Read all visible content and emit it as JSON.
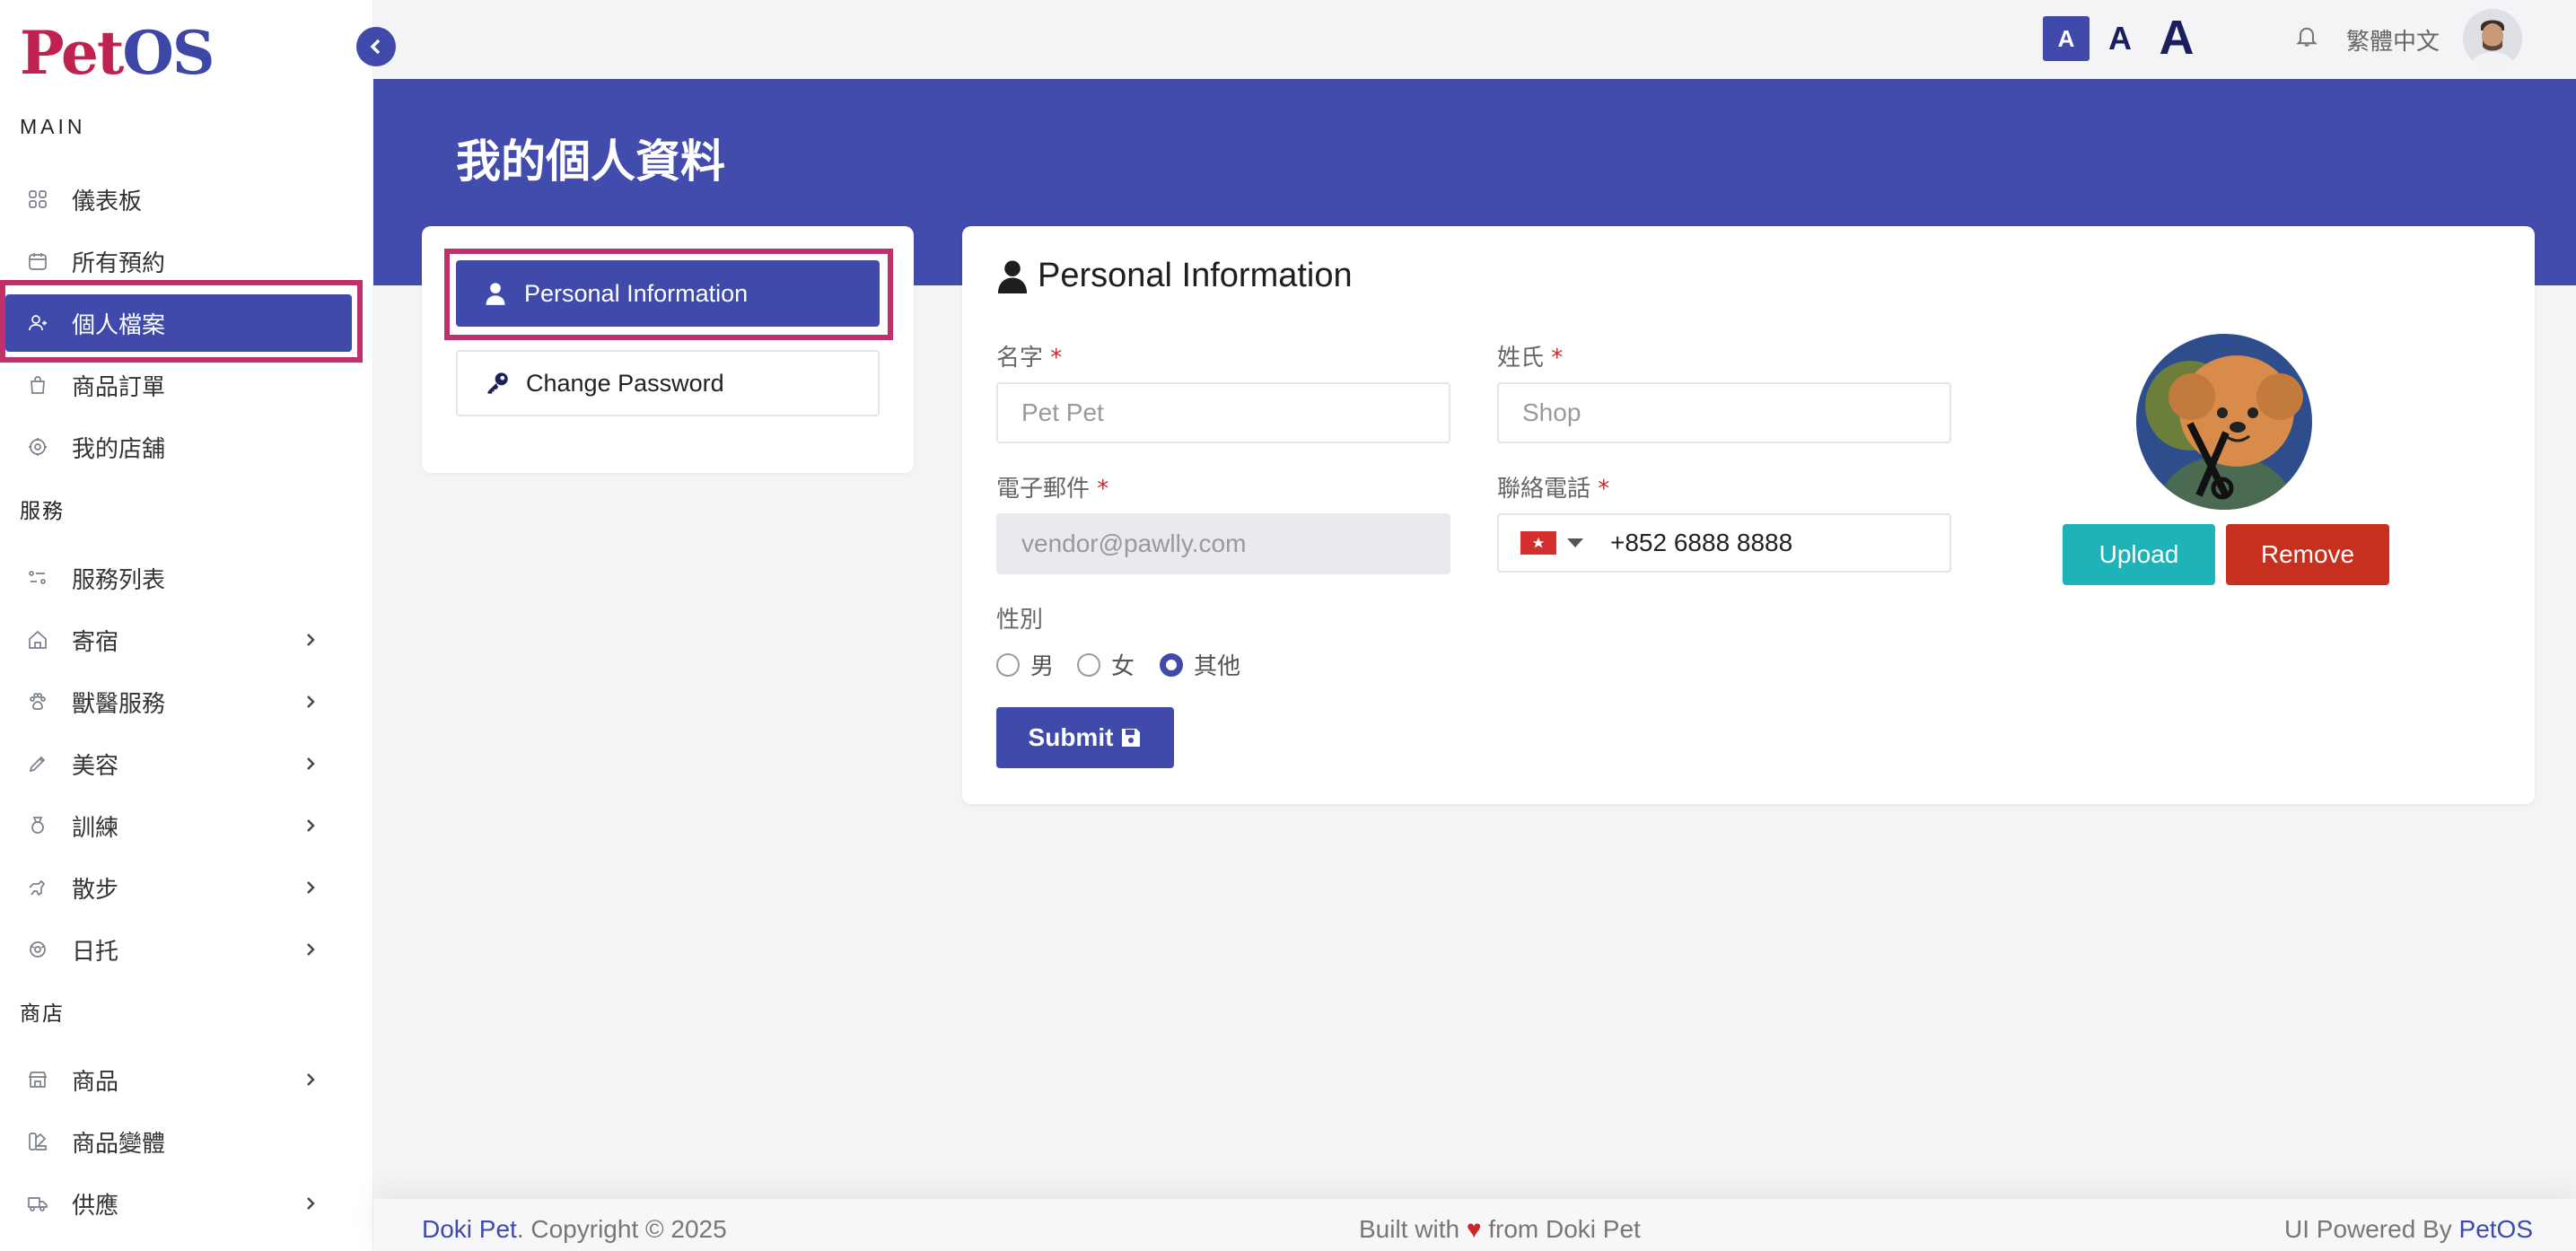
{
  "app": {
    "logo_pet": "Pet",
    "logo_os": "OS",
    "brand_color": "#c0224f",
    "accent": "#3f4aab"
  },
  "sidebar": {
    "sections": {
      "main": "MAIN",
      "services": "服務",
      "shop": "商店"
    },
    "items": [
      {
        "label": "儀表板",
        "icon": "dashboard-icon"
      },
      {
        "label": "所有預約",
        "icon": "calendar-icon"
      },
      {
        "label": "個人檔案",
        "icon": "user-icon",
        "active": true
      },
      {
        "label": "商品訂單",
        "icon": "bag-icon"
      },
      {
        "label": "我的店舖",
        "icon": "store-icon"
      },
      {
        "label": "服務列表",
        "icon": "list-icon"
      },
      {
        "label": "寄宿",
        "icon": "home-icon"
      },
      {
        "label": "獸醫服務",
        "icon": "paw-icon"
      },
      {
        "label": "美容",
        "icon": "brush-icon"
      },
      {
        "label": "訓練",
        "icon": "medal-icon"
      },
      {
        "label": "散步",
        "icon": "walk-icon"
      },
      {
        "label": "日托",
        "icon": "daycare-icon"
      },
      {
        "label": "商品",
        "icon": "shop-icon"
      },
      {
        "label": "商品變體",
        "icon": "variant-icon"
      },
      {
        "label": "供應",
        "icon": "truck-icon"
      }
    ]
  },
  "topbar": {
    "font_small": "A",
    "font_mid": "A",
    "font_large": "A",
    "language": "繁體中文"
  },
  "page": {
    "title": "我的個人資料"
  },
  "tabs": {
    "personal": "Personal Information",
    "password": "Change Password"
  },
  "form": {
    "title": "Personal Information",
    "first_name_label": "名字",
    "first_name_value": "Pet Pet",
    "last_name_label": "姓氏",
    "last_name_value": "Shop",
    "email_label": "電子郵件",
    "email_value": "vendor@pawlly.com",
    "phone_label": "聯絡電話",
    "phone_value": "+852 6888 8888",
    "required_mark": "*",
    "gender_label": "性別",
    "gender_options": [
      "男",
      "女",
      "其他"
    ],
    "gender_selected": "其他",
    "submit_label": "Submit",
    "upload_label": "Upload",
    "remove_label": "Remove"
  },
  "footer": {
    "left_brand": "Doki Pet",
    "left_text": ". Copyright © 2025",
    "center_pre": "Built with ",
    "center_heart": "♥",
    "center_post": " from Doki Pet",
    "right_pre": "UI Powered By ",
    "right_brand": "PetOS"
  }
}
